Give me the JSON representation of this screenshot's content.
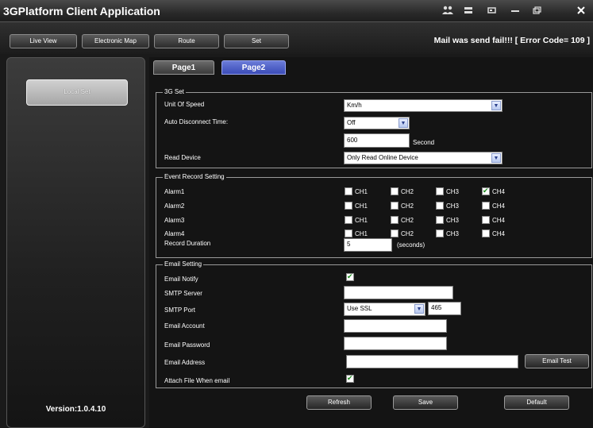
{
  "app": {
    "title": "3GPlatform Client Application"
  },
  "titlebar_icons": [
    "users-icon",
    "minimize-icon",
    "restore-icon",
    "dash-icon",
    "window-icon",
    "close-icon"
  ],
  "nav": {
    "tabs": [
      {
        "label": "Live View"
      },
      {
        "label": "Electronic Map"
      },
      {
        "label": "Route"
      },
      {
        "label": "Set"
      }
    ],
    "status": "Mail was send fail!!! [ Error Code= 109 ]"
  },
  "sidebar": {
    "local_set": "Local Set",
    "version": "Version:1.0.4.10"
  },
  "pages": {
    "page1": "Page1",
    "page2": "Page2"
  },
  "g3": {
    "legend": "3G Set",
    "speed_label": "Unit Of Speed",
    "speed_value": "Km/h",
    "disconnect_label": "Auto Disconnect Time:",
    "disconnect_value": "Off",
    "seconds_value": "600",
    "seconds_unit": "Second",
    "read_label": "Read Device",
    "read_value": "Only Read Online Device"
  },
  "event": {
    "legend": "Event Record Setting",
    "channels": [
      "CH1",
      "CH2",
      "CH3",
      "CH4"
    ],
    "alarms": [
      {
        "label": "Alarm1",
        "checked": [
          false,
          false,
          false,
          true
        ]
      },
      {
        "label": "Alarm2",
        "checked": [
          false,
          false,
          false,
          false
        ]
      },
      {
        "label": "Alarm3",
        "checked": [
          false,
          false,
          false,
          false
        ]
      },
      {
        "label": "Alarm4",
        "checked": [
          false,
          false,
          false,
          false
        ]
      }
    ],
    "duration_label": "Record Duration",
    "duration_value": "5",
    "duration_unit": "(seconds)"
  },
  "email": {
    "legend": "Email Setting",
    "notify_label": "Email Notify",
    "notify_checked": true,
    "smtp_label": "SMTP Server",
    "smtp_value": "",
    "port_label": "SMTP Port",
    "ssl_value": "Use SSL",
    "port_value": "465",
    "account_label": "Email Account",
    "account_value": "",
    "password_label": "Email Password",
    "password_value": "",
    "address_label": "Email Address",
    "address_value": "",
    "test_button": "Email Test",
    "attach_label": "Attach File When email",
    "attach_checked": true
  },
  "buttons": {
    "refresh": "Refresh",
    "save": "Save",
    "default": "Default"
  }
}
